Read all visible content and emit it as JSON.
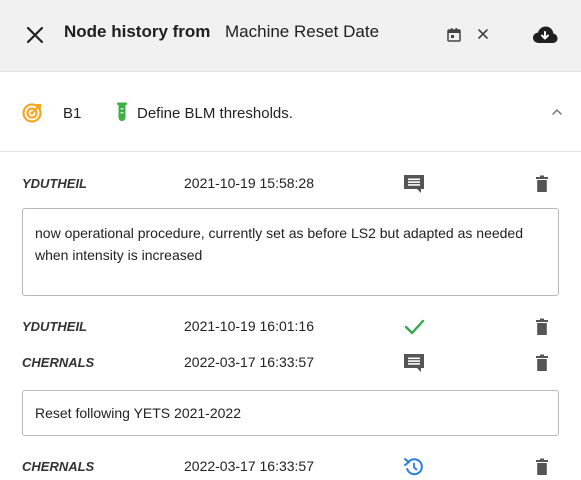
{
  "header": {
    "title": "Node history from",
    "date_field_value": "Machine Reset Date",
    "icons": [
      "close-icon",
      "calendar-icon",
      "clear-icon",
      "cloud-download-icon"
    ]
  },
  "node": {
    "id": "B1",
    "description": "Define BLM thresholds.",
    "icons": [
      "target-icon",
      "test-tube-icon",
      "chevron-up-icon"
    ]
  },
  "history": [
    {
      "user": "YDUTHEIL",
      "timestamp": "2021-10-19 15:58:28",
      "status_icon": "comment-icon",
      "comment": "now operational procedure, currently set as before LS2 but adapted as needed when intensity is increased"
    },
    {
      "user": "YDUTHEIL",
      "timestamp": "2021-10-19 16:01:16",
      "status_icon": "checkmark-icon"
    },
    {
      "user": "CHERNALS",
      "timestamp": "2022-03-17 16:33:57",
      "status_icon": "comment-icon",
      "comment": "Reset following YETS 2021-2022"
    },
    {
      "user": "CHERNALS",
      "timestamp": "2022-03-17 16:33:57",
      "status_icon": "reset-icon"
    }
  ],
  "colors": {
    "header_bg": "#f1f1f1",
    "target_orange": "#f5a623",
    "tube_green": "#3cb043",
    "check_green": "#34a853",
    "reset_blue": "#2a7de1",
    "icon_grey": "#555555"
  }
}
